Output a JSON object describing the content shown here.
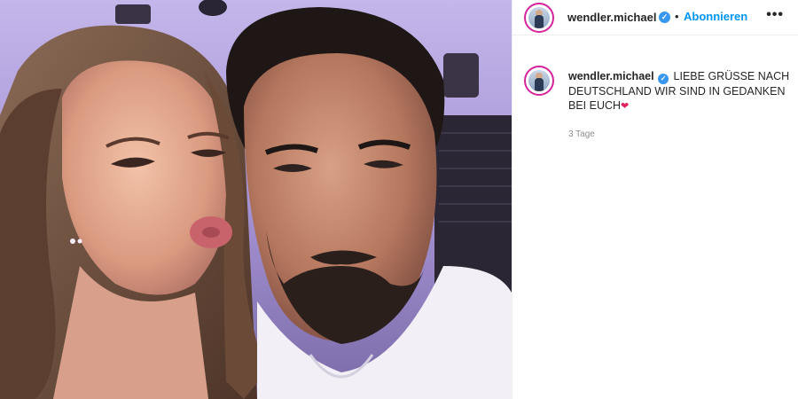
{
  "post": {
    "username": "wendler.michael",
    "follow_label": "Abonnieren",
    "separator": "•",
    "more_label": "•••",
    "verified_glyph": "✓",
    "caption_text": "LIEBE GRÜSSE NACH DEUTSCHLAND WIR SIND IN GEDANKEN BEI EUCH",
    "heart_glyph": "❤",
    "timestamp": "3 Tage"
  },
  "colors": {
    "link": "#0095f6",
    "verified": "#3897f0",
    "text": "#262626",
    "muted": "#8e8e8e"
  },
  "icons": {
    "verified": "verified-badge-icon",
    "more": "more-options-icon",
    "heart": "heart-emoji-icon"
  }
}
